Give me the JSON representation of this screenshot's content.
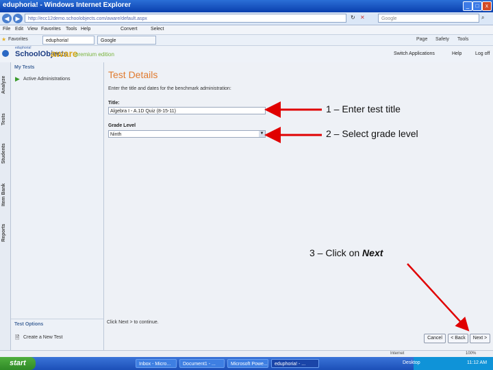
{
  "window": {
    "title": "eduphoria! - Windows Internet Explorer",
    "controls": [
      "_",
      "□",
      "x"
    ]
  },
  "address_bar": {
    "url": "http://ecc12demo.schoolobjects.com/aware/default.aspx",
    "search_placeholder": "Google"
  },
  "menu": {
    "items": [
      "File",
      "Edit",
      "View",
      "Favorites",
      "Tools",
      "Help"
    ],
    "convert": "Convert",
    "select": "Select"
  },
  "favorites_bar": {
    "favorites_label": "Favorites",
    "tabs": [
      "eduphoria!",
      "Google"
    ],
    "right_items": [
      "Page",
      "Safety",
      "Tools"
    ]
  },
  "app_header": {
    "logo_small": "eduphoria!",
    "logo_main": "SchoolObjects",
    "logo_aware": "aware",
    "edition": "premium edition",
    "switch_apps": "Switch Applications",
    "help": "Help",
    "logoff": "Log off"
  },
  "side_tabs": [
    "Analyze",
    "Tests",
    "Students",
    "Item Bank",
    "Reports"
  ],
  "left_nav": {
    "heading": "My Tests",
    "item": "Active Administrations",
    "options_heading": "Test Options",
    "options_item": "Create a New Test"
  },
  "main": {
    "heading": "Test Details",
    "instructions": "Enter the title and dates for the benchmark administration:",
    "title_label": "Title:",
    "title_value": "Algebra I - A.1D Quiz (8-15-11)",
    "grade_label": "Grade Level",
    "grade_value": "Ninth",
    "footer_text": "Click Next > to continue.",
    "buttons": {
      "cancel": "Cancel",
      "back": "< Back",
      "next": "Next >"
    }
  },
  "status_bar": {
    "zone": "Internet",
    "zoom": "100%"
  },
  "taskbar": {
    "start": "start",
    "tasks": [
      "Inbox - Micro...",
      "Document1 - ...",
      "Microsoft Powe...",
      "eduphoria! - ..."
    ],
    "desktop": "Desktop",
    "clock": "11:12 AM"
  },
  "annotations": {
    "step1": "1 – Enter test title",
    "step2": "2 – Select grade level",
    "step3_prefix": "3 – Click on ",
    "step3_emph": "Next"
  },
  "colors": {
    "accent_orange": "#e07a2e",
    "annotation_red": "#e00000",
    "titlebar_blue": "#0a3fae"
  }
}
